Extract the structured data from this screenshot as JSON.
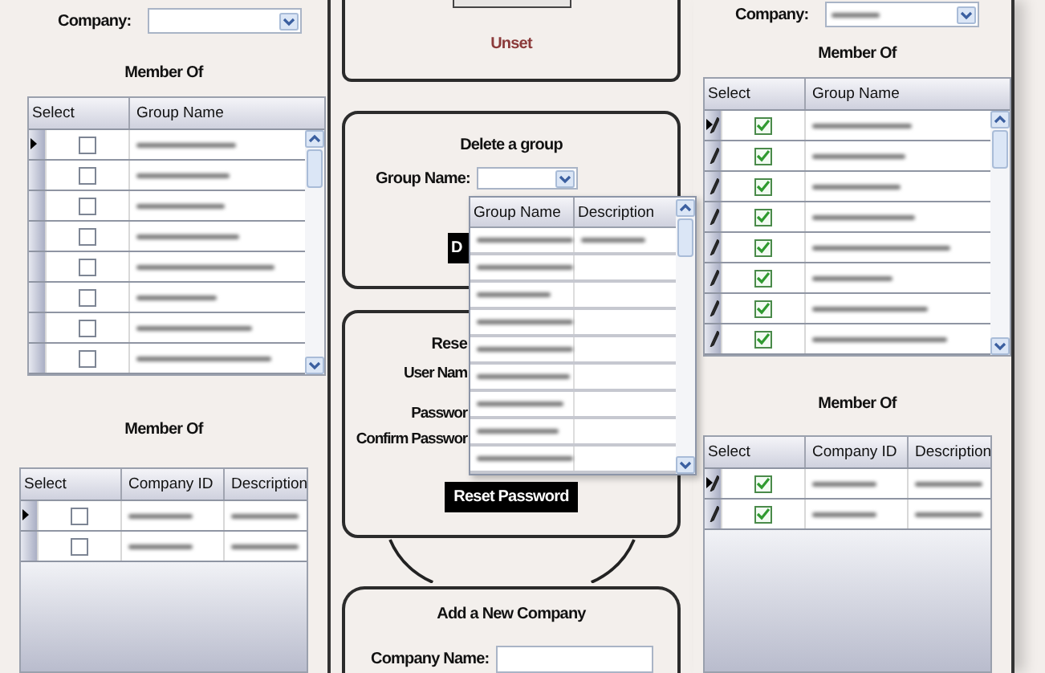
{
  "left_panel": {
    "company": {
      "label": "Company:"
    },
    "groups": {
      "title": "Member Of",
      "columns": [
        "Select",
        "Group Name"
      ],
      "rows": [
        {
          "current": true,
          "editing": false,
          "checked": false
        },
        {
          "current": false,
          "editing": false,
          "checked": false
        },
        {
          "current": false,
          "editing": false,
          "checked": false
        },
        {
          "current": false,
          "editing": false,
          "checked": false
        },
        {
          "current": false,
          "editing": false,
          "checked": false
        },
        {
          "current": false,
          "editing": false,
          "checked": false
        },
        {
          "current": false,
          "editing": false,
          "checked": false
        },
        {
          "current": false,
          "editing": false,
          "checked": false
        }
      ]
    },
    "companies": {
      "title": "Member Of",
      "columns": [
        "Select",
        "Company ID",
        "Description"
      ],
      "rows": [
        {
          "current": true,
          "editing": false,
          "checked": false
        },
        {
          "current": false,
          "editing": false,
          "checked": false
        }
      ]
    }
  },
  "center": {
    "unset_button": "Unset",
    "delete_group": {
      "title": "Delete a group",
      "group_label": "Group Name:",
      "button": "D"
    },
    "dropdown": {
      "columns": [
        "Group Name",
        "Description"
      ],
      "rows": [
        {
          "description_blurred": true
        },
        {
          "description_blurred": false
        },
        {
          "description_blurred": false
        },
        {
          "description_blurred": false
        },
        {
          "description_blurred": false
        },
        {
          "description_blurred": false
        },
        {
          "description_blurred": false
        },
        {
          "description_blurred": false
        },
        {
          "description_blurred": false
        }
      ]
    },
    "reset_password": {
      "title": "Rese",
      "labels": [
        "User Nam",
        "Passwor",
        "Confirm Passwor"
      ],
      "button": "Reset Password"
    },
    "add_company": {
      "title": "Add a New Company",
      "name_label": "Company Name:"
    }
  },
  "right_panel": {
    "company": {
      "label": "Company:"
    },
    "groups": {
      "title": "Member Of",
      "columns": [
        "Select",
        "Group Name"
      ],
      "rows": [
        {
          "current": true,
          "editing": true,
          "checked": true
        },
        {
          "current": false,
          "editing": true,
          "checked": true
        },
        {
          "current": false,
          "editing": true,
          "checked": true
        },
        {
          "current": false,
          "editing": true,
          "checked": true
        },
        {
          "current": false,
          "editing": true,
          "checked": true
        },
        {
          "current": false,
          "editing": true,
          "checked": true
        },
        {
          "current": false,
          "editing": true,
          "checked": true
        },
        {
          "current": false,
          "editing": true,
          "checked": true
        }
      ]
    },
    "companies": {
      "title": "Member Of",
      "columns": [
        "Select",
        "Company ID",
        "Description"
      ],
      "rows": [
        {
          "current": true,
          "editing": true,
          "checked": true
        },
        {
          "current": false,
          "editing": true,
          "checked": true
        }
      ]
    }
  }
}
